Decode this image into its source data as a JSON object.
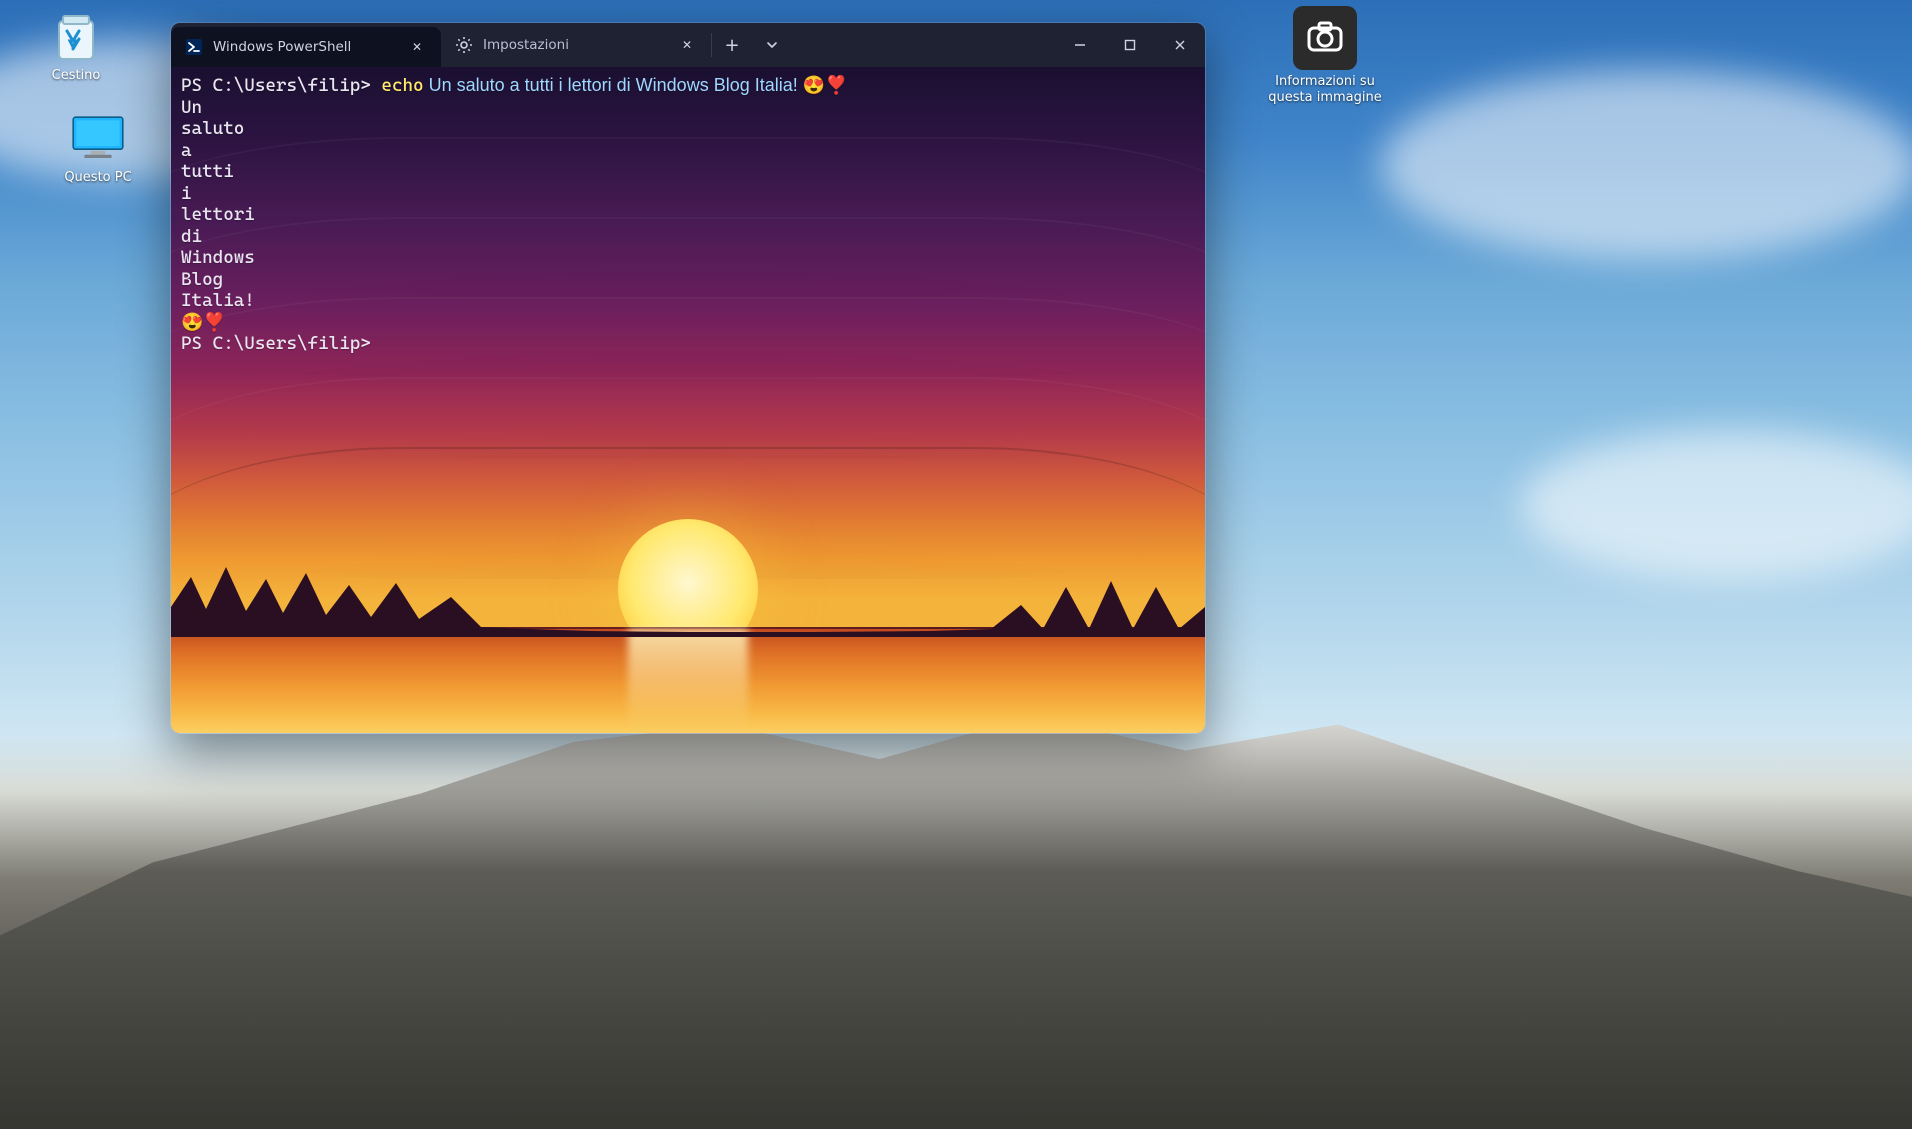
{
  "desktop": {
    "icons": {
      "recycle_bin": "Cestino",
      "this_pc": "Questo PC",
      "image_info": "Informazioni su questa immagine"
    }
  },
  "window": {
    "tabs": [
      {
        "label": "Windows PowerShell",
        "icon": "powershell",
        "active": true
      },
      {
        "label": "Impostazioni",
        "icon": "settings",
        "active": false
      }
    ]
  },
  "terminal": {
    "prompt1_prefix": "PS C:\\Users\\filip> ",
    "prompt1_cmd": "echo",
    "prompt1_args": " Un saluto a tutti i lettori di Windows Blog Italia! 😍❣️",
    "output_lines": [
      "Un",
      "saluto",
      "a",
      "tutti",
      "i",
      "lettori",
      "di",
      "Windows",
      "Blog",
      "Italia!",
      "😍❣️"
    ],
    "prompt2": "PS C:\\Users\\filip>"
  }
}
